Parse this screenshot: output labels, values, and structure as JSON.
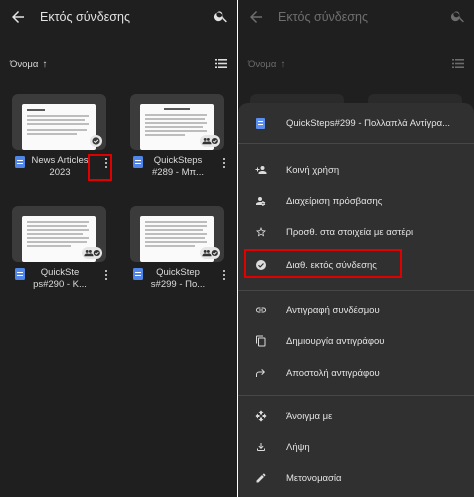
{
  "left": {
    "title": "Εκτός σύνδεσης",
    "sort_label": "Όνομα",
    "sort_arrow": "↑",
    "files": [
      {
        "name": "News Articles 2023"
      },
      {
        "name": "QuickSteps #289 - Μπ..."
      },
      {
        "name": "QuickSte ps#290 - Κ..."
      },
      {
        "name": "QuickStep s#299 - Πο..."
      }
    ]
  },
  "right": {
    "title": "Εκτός σύνδεσης",
    "sort_label": "Όνομα",
    "sort_arrow": "↑",
    "sheet_title": "QuickSteps#299 - Πολλαπλά Αντίγρα...",
    "menu": [
      {
        "label": "Κοινή χρήση",
        "icon": "person-add-icon"
      },
      {
        "label": "Διαχείριση πρόσβασης",
        "icon": "manage-access-icon"
      },
      {
        "label": "Προσθ. στα στοιχεία με αστέρι",
        "icon": "star-icon"
      },
      {
        "label": "Διαθ. εκτός σύνδεσης",
        "icon": "offline-check-icon"
      },
      {
        "label": "Αντιγραφή συνδέσμου",
        "icon": "link-icon"
      },
      {
        "label": "Δημιουργία αντιγράφου",
        "icon": "copy-icon"
      },
      {
        "label": "Αποστολή αντιγράφου",
        "icon": "send-copy-icon"
      },
      {
        "label": "Άνοιγμα με",
        "icon": "open-with-icon"
      },
      {
        "label": "Λήψη",
        "icon": "download-icon"
      },
      {
        "label": "Μετονομασία",
        "icon": "rename-icon"
      }
    ]
  },
  "colors": {
    "background": "#1f1f1f",
    "sheet": "#303030",
    "highlight": "#e00000",
    "doc_blue": "#4f86e8"
  }
}
